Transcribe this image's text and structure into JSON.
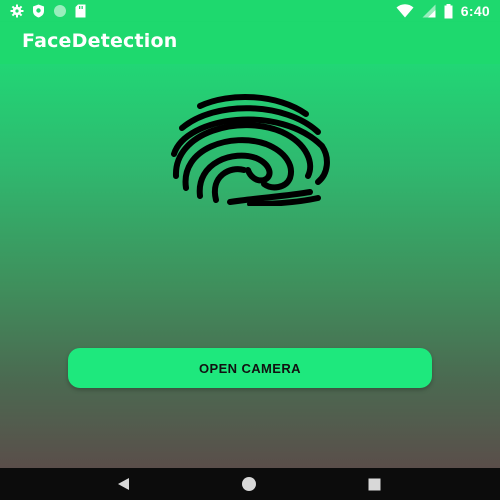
{
  "status_bar": {
    "time": "6:40",
    "icons": [
      "gear-icon",
      "shield-icon",
      "circle-icon",
      "sd-card-icon",
      "wifi-icon",
      "signal-icon",
      "battery-icon"
    ]
  },
  "app_bar": {
    "title": "FaceDetection"
  },
  "main": {
    "fingerprint_icon": "fingerprint-icon",
    "open_camera_label": "OPEN CAMERA"
  },
  "nav_bar": {
    "icons": [
      "back-icon",
      "home-icon",
      "recents-icon"
    ]
  },
  "colors": {
    "primary": "#1ed96e",
    "button": "#1ee87d",
    "gradient_top": "#21d675",
    "gradient_bottom": "#5a4e4a"
  }
}
